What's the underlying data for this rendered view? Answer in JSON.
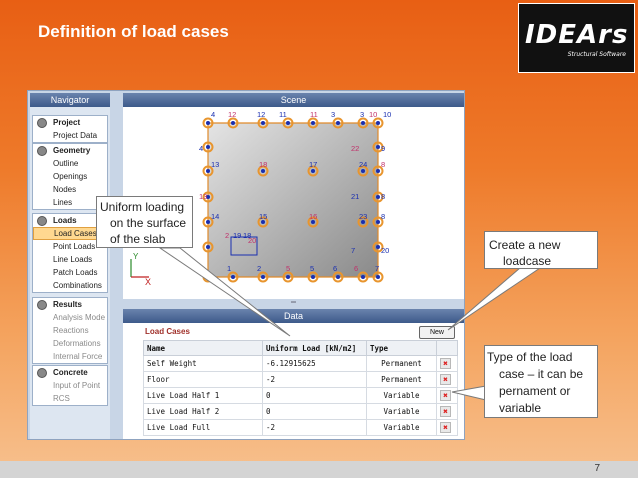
{
  "slide": {
    "title": "Definition of load cases",
    "page_number": "7"
  },
  "logo": {
    "main": "IDEA",
    "rs": "rs",
    "sub": "Structural Software"
  },
  "navigator": {
    "title": "Navigator",
    "groups": [
      {
        "title": "Project",
        "items": [
          {
            "label": "Project Data",
            "dim": false
          }
        ]
      },
      {
        "title": "Geometry",
        "items": [
          {
            "label": "Outline",
            "dim": false
          },
          {
            "label": "Openings",
            "dim": false
          },
          {
            "label": "Nodes",
            "dim": false
          },
          {
            "label": "Lines",
            "dim": false
          }
        ]
      },
      {
        "title": "Loads",
        "items": [
          {
            "label": "Load Cases",
            "dim": false,
            "selected": true
          },
          {
            "label": "Point Loads",
            "dim": false
          },
          {
            "label": "Line Loads",
            "dim": false
          },
          {
            "label": "Patch Loads",
            "dim": false
          },
          {
            "label": "Combinations",
            "dim": false
          }
        ]
      },
      {
        "title": "Results",
        "items": [
          {
            "label": "Analysis Mode",
            "dim": true
          },
          {
            "label": "Reactions",
            "dim": true
          },
          {
            "label": "Deformations",
            "dim": true
          },
          {
            "label": "Internal Force",
            "dim": true
          }
        ]
      },
      {
        "title": "Concrete",
        "items": [
          {
            "label": "Input of Point",
            "dim": true
          },
          {
            "label": "RCS",
            "dim": true
          }
        ]
      }
    ]
  },
  "scene": {
    "title": "Scene",
    "axis_y": "Y",
    "axis_x": "X",
    "node_labels": [
      "4",
      "12",
      "12",
      "11",
      "11",
      "3",
      "3",
      "10",
      "10",
      "4",
      "22",
      "9",
      "13",
      "18",
      "17",
      "24",
      "8",
      "21",
      "8",
      "13",
      "14",
      "15",
      "16",
      "23",
      "8",
      "2",
      "19",
      "18",
      "20",
      "7",
      "20",
      "1",
      "1",
      "2",
      "5",
      "5",
      "6",
      "6",
      "7"
    ]
  },
  "data_panel": {
    "title": "Data",
    "section_title": "Load Cases",
    "new_button": "New",
    "columns": [
      "Name",
      "Uniform Load [kN/m2]",
      "Type"
    ],
    "rows": [
      {
        "name": "Self Weight",
        "load": "-6.12915625",
        "type": "Permanent"
      },
      {
        "name": "Floor",
        "load": "-2",
        "type": "Permanent"
      },
      {
        "name": "Live Load Half 1",
        "load": "0",
        "type": "Variable"
      },
      {
        "name": "Live Load Half 2",
        "load": "0",
        "type": "Variable"
      },
      {
        "name": "Live Load Full",
        "load": "-2",
        "type": "Variable"
      }
    ]
  },
  "callouts": {
    "slab": [
      "Uniform loading",
      "on the surface",
      "of the slab"
    ],
    "new": [
      "Create a new",
      "loadcase"
    ],
    "type": [
      "Type of the load",
      "case – it can be",
      "pernament or",
      "variable"
    ]
  },
  "colors": {
    "accent": "#e8661b",
    "header_blue": "#4a6595",
    "selected": "#ffd890"
  }
}
